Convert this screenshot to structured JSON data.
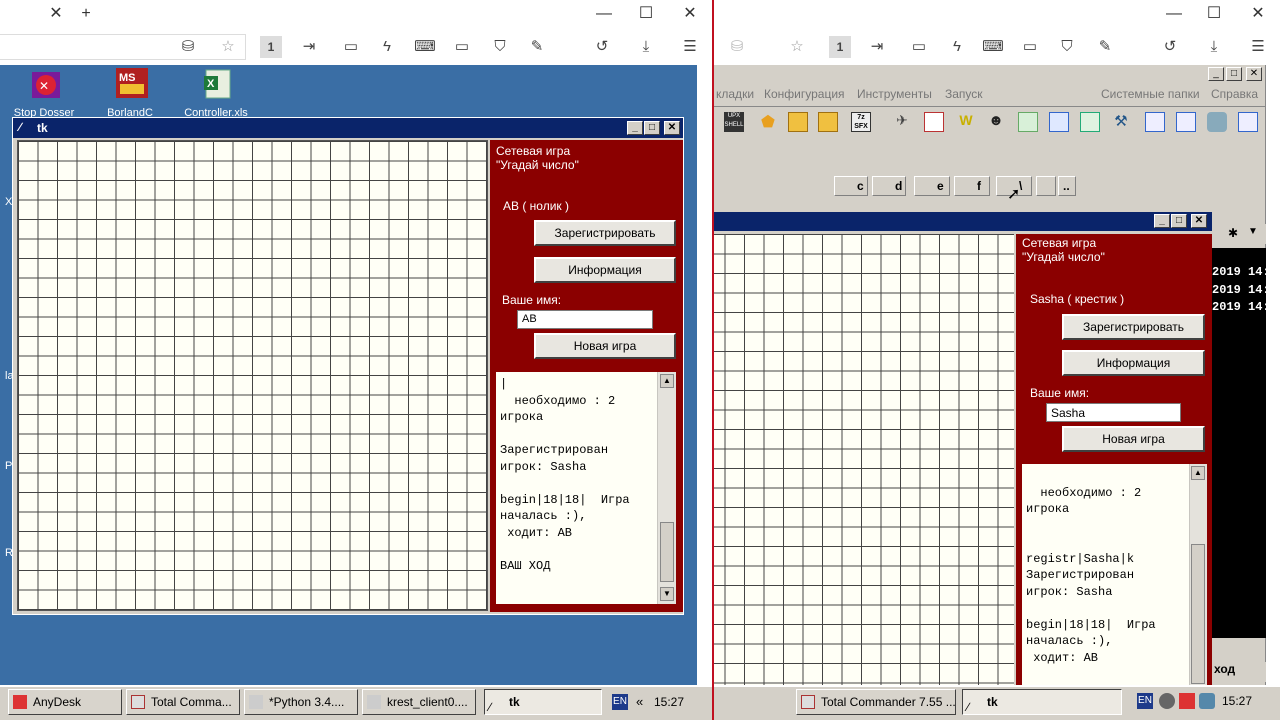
{
  "left_browser": {
    "win_controls": [
      "✕",
      "+"
    ],
    "minimize": "—",
    "maximize": "☐",
    "close": "✕",
    "tab_number": "1"
  },
  "right_browser": {
    "minimize": "—",
    "maximize": "☐",
    "close": "✕",
    "tab_number": "1"
  },
  "desktop": {
    "icons": [
      {
        "label": "Stop Dosser",
        "icon": "stop-dosser-icon"
      },
      {
        "label": "BorlandC",
        "icon": "borland-icon",
        "glyph": "MS"
      },
      {
        "label": "Controller.xls",
        "icon": "excel-icon",
        "glyph": "X"
      }
    ],
    "edge_letters": [
      "X",
      "la",
      "P",
      "R"
    ]
  },
  "tk_left": {
    "title": "tk",
    "game_title": "Сетевая игра\n\"Угадай число\"",
    "player": "АВ ( нолик )",
    "register_button": "Зарегистрировать",
    "info_button": "Информация",
    "name_label": "Ваше имя:",
    "name_value": "АВ",
    "new_game_button": "Новая игра",
    "log": "|\n  необходимо : 2\nигрока\n\nЗарегистрирован\nигрок: Sasha\n\nbegin|18|18|  Игра\nначалась :),\n ходит: АВ\n\nВАШ ХОД"
  },
  "tk_right": {
    "game_title": "Сетевая игра\n\"Угадай число\"",
    "player": "Sasha ( крестик )",
    "register_button": "Зарегистрировать",
    "info_button": "Информация",
    "name_label": "Ваше имя:",
    "name_value": "Sasha",
    "new_game_button": "Новая игра",
    "log": "\n  необходимо : 2\nигрока\n\n\nregistr|Sasha|k\nЗарегистрирован\nигрок: Sasha\n\nbegin|18|18|  Игра\nначалась :),\n ходит: АВ"
  },
  "total_commander": {
    "menu": [
      "кладки",
      "Конфигурация",
      "Инструменты",
      "Запуск",
      "Системные папки",
      "Справка"
    ],
    "drives": [
      "c",
      "d",
      "e",
      "f",
      "\\",
      ".."
    ],
    "dates": [
      "2019 14:",
      "2019 14:",
      "2019 14:"
    ],
    "exit_label": "ход",
    "toolbar_labels": [
      "UPX SHELL",
      "7z SFX",
      "W"
    ]
  },
  "taskbar_left": {
    "buttons": [
      "AnyDesk",
      "Total Comma...",
      "*Python 3.4....",
      "krest_client0....",
      "tk"
    ],
    "lang": "EN",
    "arrows": "«",
    "clock": "15:27"
  },
  "taskbar_right": {
    "buttons": [
      "Total Commander 7.55 ...",
      "tk"
    ],
    "lang": "EN",
    "clock": "15:27"
  },
  "colors": {
    "desktop": "#3a6ea5",
    "panel": "#8b0000",
    "titlebar": "#0a246a",
    "grid_bg": "#fffff6"
  }
}
